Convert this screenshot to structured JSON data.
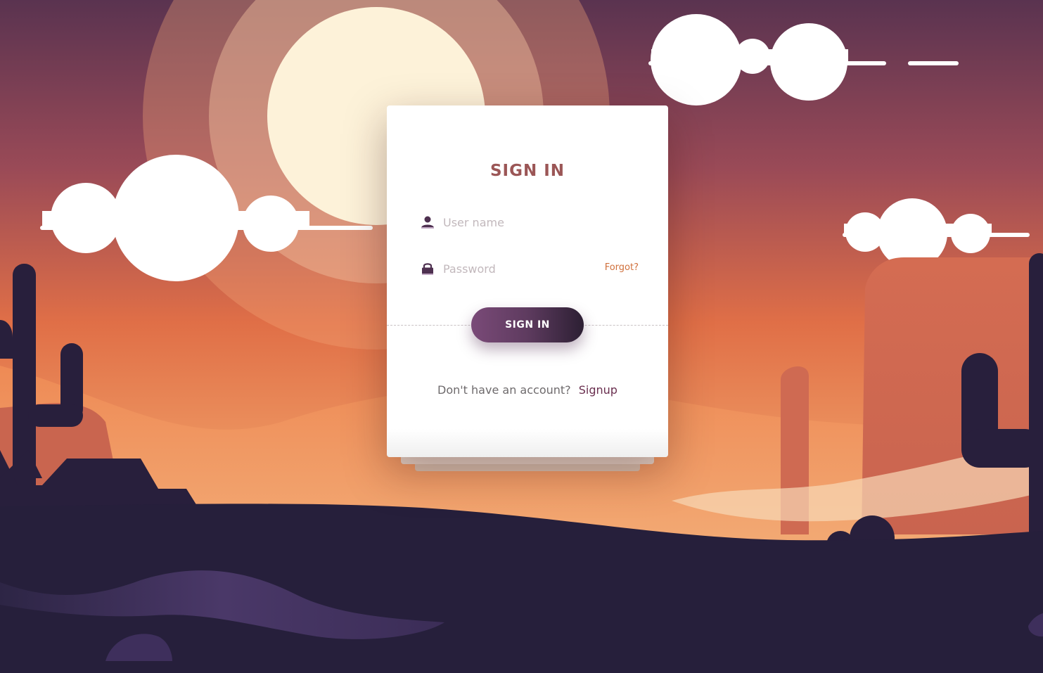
{
  "login_card": {
    "title": "SIGN IN",
    "username_placeholder": "User name",
    "password_placeholder": "Password",
    "forgot_label": "Forgot?",
    "submit_label": "SIGN IN",
    "no_account_text": "Don't have an account?",
    "signup_label": "Signup",
    "username_icon": "user-icon",
    "password_icon": "lock-icon"
  },
  "colors": {
    "title": "#9b5656",
    "forgot": "#d0703c",
    "button_start": "#7a4a78",
    "button_end": "#2c1f33",
    "signup_link": "#6a2f4f",
    "sky_top": "#5c3350",
    "sky_mid": "#e07047",
    "ground": "#261f3b"
  }
}
